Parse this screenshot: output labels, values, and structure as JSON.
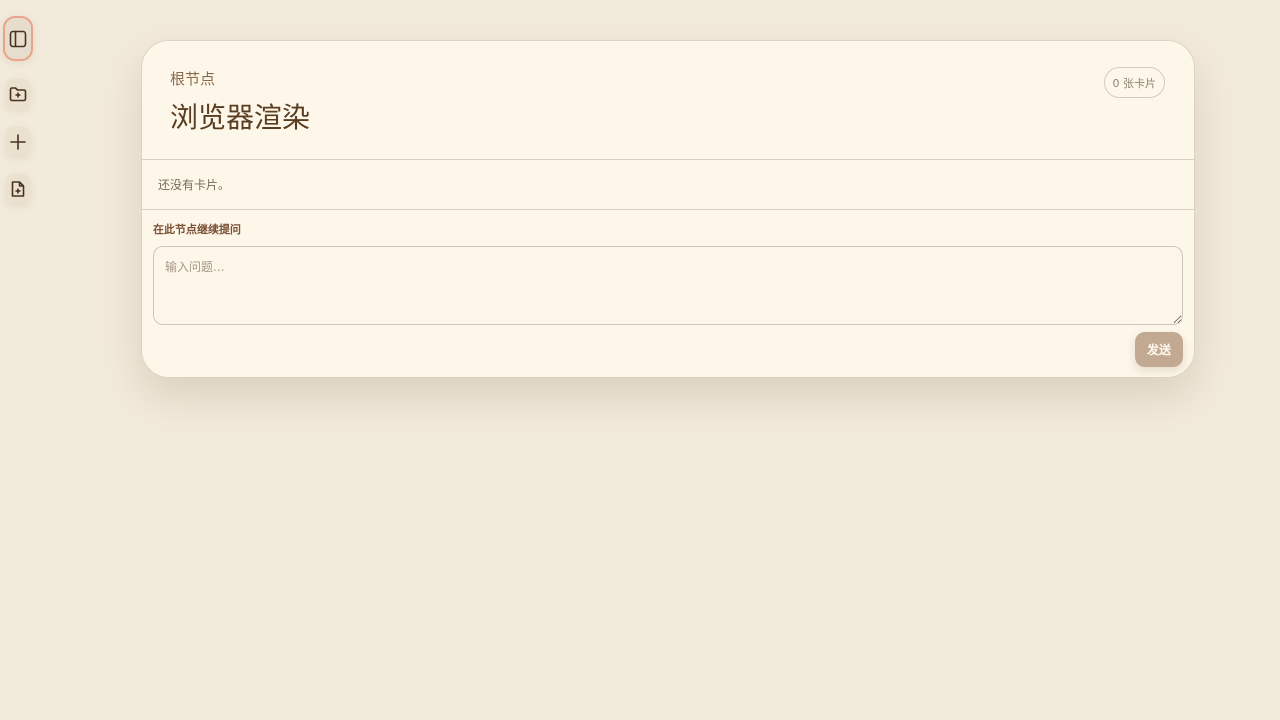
{
  "toolbar": {
    "items": [
      {
        "icon": "sidebar-toggle-icon",
        "active": true
      },
      {
        "icon": "folder-plus-icon",
        "active": false
      },
      {
        "icon": "plus-icon",
        "active": false
      },
      {
        "icon": "file-plus-icon",
        "active": false
      }
    ]
  },
  "card": {
    "breadcrumb": "根节点",
    "title": "浏览器渲染",
    "card_count": "0 张卡片",
    "empty_message": "还没有卡片。"
  },
  "ask": {
    "label": "在此节点继续提问",
    "placeholder": "输入问题...",
    "value": "",
    "send_label": "发送"
  },
  "colors": {
    "background": "#f2eadb",
    "card": "#fdf7ea",
    "accent_border": "#e8a48a",
    "send_button": "#c2aa92",
    "text": "#5a3c1f"
  }
}
